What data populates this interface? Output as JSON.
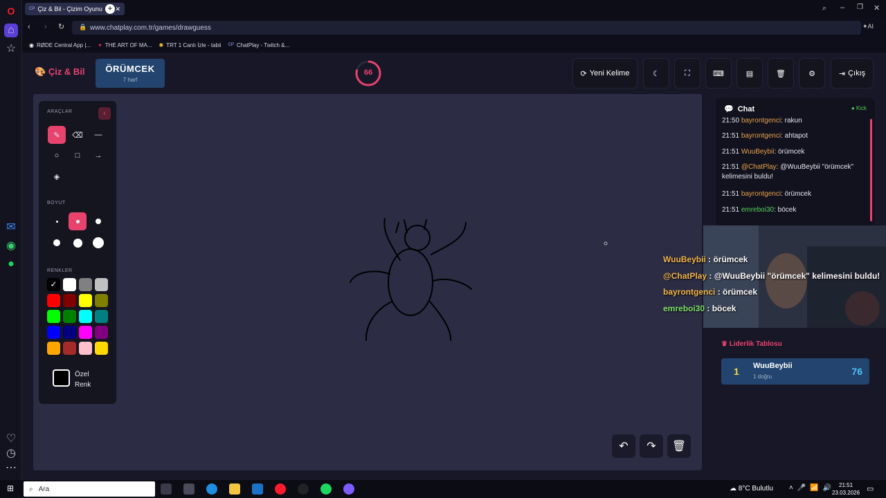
{
  "browser": {
    "tab_title": "Çiz & Bil - Çizim Oyunu",
    "tab_favicon": "CP",
    "url": "www.chatplay.com.tr/games/drawguess",
    "ai_label": "AI",
    "bookmarks": [
      {
        "label": "RØDE Central App |..."
      },
      {
        "label": "THE ART OF MA..."
      },
      {
        "label": "TRT 1 Canlı İzle - tabii"
      },
      {
        "label": "ChatPlay - Twitch &..."
      }
    ]
  },
  "header": {
    "logo": "Çiz & Bil",
    "word": "ÖRÜMCEK",
    "word_sub": "7 harf",
    "timer": "66",
    "timer_fraction": 0.8,
    "new_word_label": "Yeni Kelime",
    "exit_label": "Çıkış"
  },
  "tools": {
    "title": "ARAÇLAR",
    "size_title": "BOYUT",
    "colors_title": "RENKLER",
    "custom_color_label_1": "Özel",
    "custom_color_label_2": "Renk",
    "colors": [
      "#000000",
      "#ffffff",
      "#808080",
      "#c0c0c0",
      "#ff0000",
      "#800000",
      "#ffff00",
      "#808000",
      "#00ff00",
      "#008000",
      "#00ffff",
      "#008080",
      "#0000ff",
      "#000080",
      "#ff00ff",
      "#800080",
      "#ffa500",
      "#a52a2a",
      "#ffc0cb",
      "#ffd700"
    ],
    "selected_color": "#000000"
  },
  "chat": {
    "title": "Chat",
    "status": "Kick",
    "messages": [
      {
        "time": "21:50",
        "user": "bayrontgenci",
        "text": ": rakun",
        "user_color": "orange"
      },
      {
        "time": "21:51",
        "user": "bayrontgenci",
        "text": ": ahtapot",
        "user_color": "orange"
      },
      {
        "time": "21:51",
        "user": "WuuBeybii",
        "text": ": örümcek",
        "user_color": "orange"
      },
      {
        "time": "21:51",
        "user": "@ChatPlay",
        "text": ": @WuuBeybii \"örümcek\"",
        "text2": "kelimesini buldu!",
        "user_color": "orange"
      },
      {
        "time": "21:51",
        "user": "bayrontgenci",
        "text": ": örümcek",
        "user_color": "orange"
      },
      {
        "time": "21:51",
        "user": "emreboi30",
        "text": ": böcek",
        "user_color": "green"
      }
    ]
  },
  "overlay": {
    "lines": [
      {
        "user": "WuuBeybii",
        "text": " : örümcek"
      },
      {
        "user": "@ChatPlay",
        "text": " : @WuuBeybii \"örümcek\" kelimesini buldu!"
      },
      {
        "user": "bayrontgenci",
        "text": " : örümcek"
      },
      {
        "user": "emreboi30",
        "text": " : böcek"
      }
    ]
  },
  "leaderboard": {
    "title": "Liderlik Tablosu",
    "rows": [
      {
        "rank": "1",
        "name": "WuuBeybii",
        "sub": "1 doğru",
        "score": "76"
      }
    ]
  },
  "taskbar": {
    "search_placeholder": "Ara",
    "weather": "8°C  Bulutlu",
    "time": "21:51",
    "date": "23.03.2026"
  }
}
